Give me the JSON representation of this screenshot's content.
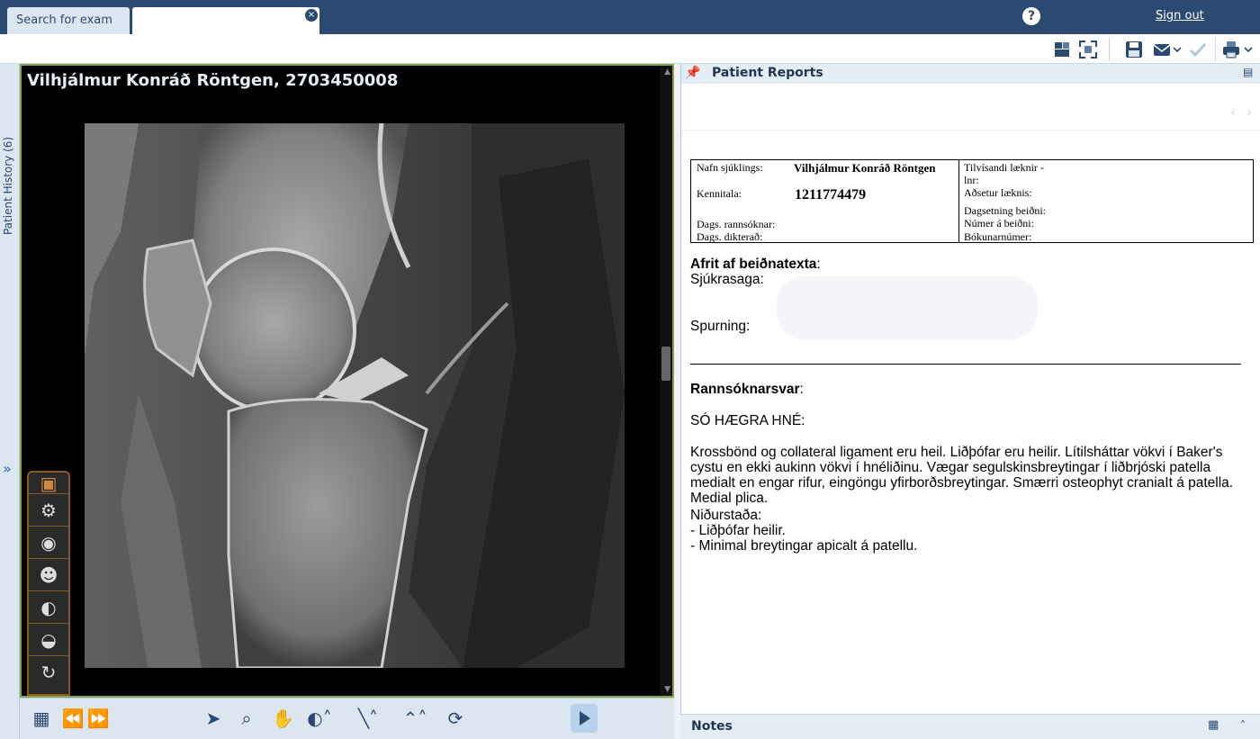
{
  "tabs": {
    "search_label": "Search for exam",
    "active_label": ""
  },
  "header": {
    "help_label": "?",
    "sign_out_label": "Sign out"
  },
  "rail": {
    "label": "Patient History (6)",
    "expand_glyph": "»"
  },
  "viewer": {
    "title": "Vilhjálmur Konráð Röntgen, 2703450008"
  },
  "reports": {
    "title": "Patient Reports",
    "nav": "‹ ›",
    "table": {
      "name_label": "Nafn sjúklings:",
      "name_value": "Vilhjálmur Konráð Röntgen",
      "kt_label": "Kennitala:",
      "kt_value": "1211774479",
      "exam_date_label": "Dags. rannsóknar:",
      "dictated_label": "Dags. dikterað:",
      "ref_doctor_label": "Tilvísandi læknir -",
      "lnr_label": "lnr:",
      "doctor_location_label": "Aðsetur læknis:",
      "req_date_label": "Dagsetning beiðni:",
      "req_number_label": "Númer á beiðni:",
      "booking_label": "Bókunarnúmer:"
    },
    "body": {
      "req_text_heading": "Afrit af beiðnatexta",
      "req_text_colon": ":",
      "history_label": "Sjúkrasaga:",
      "question_label": "Spurning:",
      "answer_heading": "Rannsóknarsvar",
      "answer_colon": ":",
      "exam_title": "SÓ HÆGRA HNÉ:",
      "findings": "Krossbönd og collateral ligament eru heil. Liðþófar eru heilir. Lítilsháttar vökvi í Baker's cystu en ekki aukinn vökvi í hnéliðinu. Vægar segulskinsbreytingar í liðbrjóski patella medialt en engar rifur, eingöngu yfirborðsbreytingar. Smærri osteophyt craniaIt á patella. Medial plica.",
      "conclusion_label": "Niðurstaða:",
      "conclusion_1": "- Liðþófar heilir.",
      "conclusion_2": "- Minimal breytingar apicalt á patellu."
    }
  },
  "notes": {
    "title": "Notes"
  }
}
